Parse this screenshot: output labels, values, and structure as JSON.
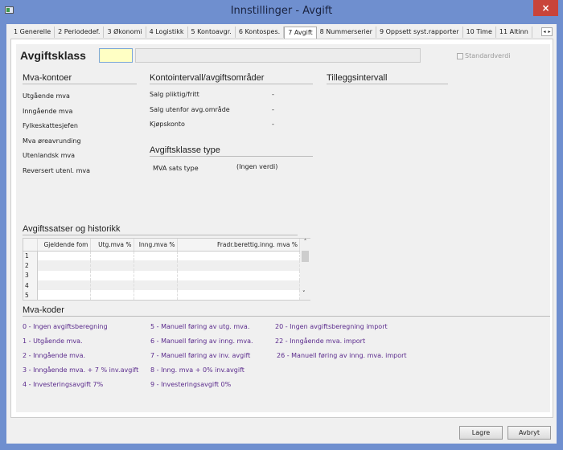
{
  "window": {
    "title": "Innstillinger - Avgift",
    "close_icon": "×"
  },
  "tabs": [
    "1 Generelle",
    "2 Periodedef.",
    "3 Økonomi",
    "4 Logistikk",
    "5 Kontoavgr.",
    "6 Kontospes.",
    "7 Avgift",
    "8 Nummerserier",
    "9 Oppsett syst.rapporter",
    "10 Time",
    "11 Altinn"
  ],
  "tab_scroll": {
    "left": "◂",
    "right": "▸"
  },
  "klass": {
    "label": "Avgiftsklass",
    "code": "",
    "description": "",
    "standard_label": "Standardverdi"
  },
  "mva_kontoer": {
    "title": "Mva-kontoer",
    "items": [
      "Utgående mva",
      "Inngående mva",
      "Fylkeskattesjefen",
      "Mva øreavrunding",
      "Utenlandsk mva",
      "Reversert utenl. mva"
    ]
  },
  "kontointervall": {
    "title": "Kontointervall/avgiftsområder",
    "items": [
      {
        "label": "Salg pliktig/fritt",
        "value": "-"
      },
      {
        "label": "Salg utenfor avg.område",
        "value": "-"
      },
      {
        "label": "Kjøpskonto",
        "value": "-"
      }
    ]
  },
  "tillegg": {
    "title": "Tilleggsintervall"
  },
  "klasse_type": {
    "title": "Avgiftsklasse type",
    "label": "MVA sats type",
    "value": "(Ingen verdi)"
  },
  "satser": {
    "title": "Avgiftssatser og historikk",
    "columns": [
      "Gjeldende fom",
      "Utg.mva %",
      "Inng.mva %",
      "Fradr.berettig.inng. mva %"
    ],
    "rows": [
      "1",
      "2",
      "3",
      "4",
      "5"
    ],
    "scroll_up": "˄",
    "scroll_down": "˅"
  },
  "mva_koder": {
    "title": "Mva-koder",
    "columns": [
      [
        "0 - Ingen avgiftsberegning",
        "1 - Utgående mva.",
        "2 - Inngående mva.",
        "3 - Inngående mva. + 7 % inv.avgift",
        "4 - Investeringsavgift 7%"
      ],
      [
        "5 - Manuell føring av utg. mva.",
        "6 - Manuell føring av inng. mva.",
        "7 - Manuell føring av inv. avgift",
        "8 - Inng. mva + 0% inv.avgift",
        "9 - Investeringsavgift 0%"
      ],
      [
        "20 - Ingen avgiftsberegning import",
        "22 - Inngående mva. import",
        "26 - Manuell føring av inng. mva. import"
      ]
    ]
  },
  "buttons": {
    "save": "Lagre",
    "cancel": "Avbryt"
  }
}
